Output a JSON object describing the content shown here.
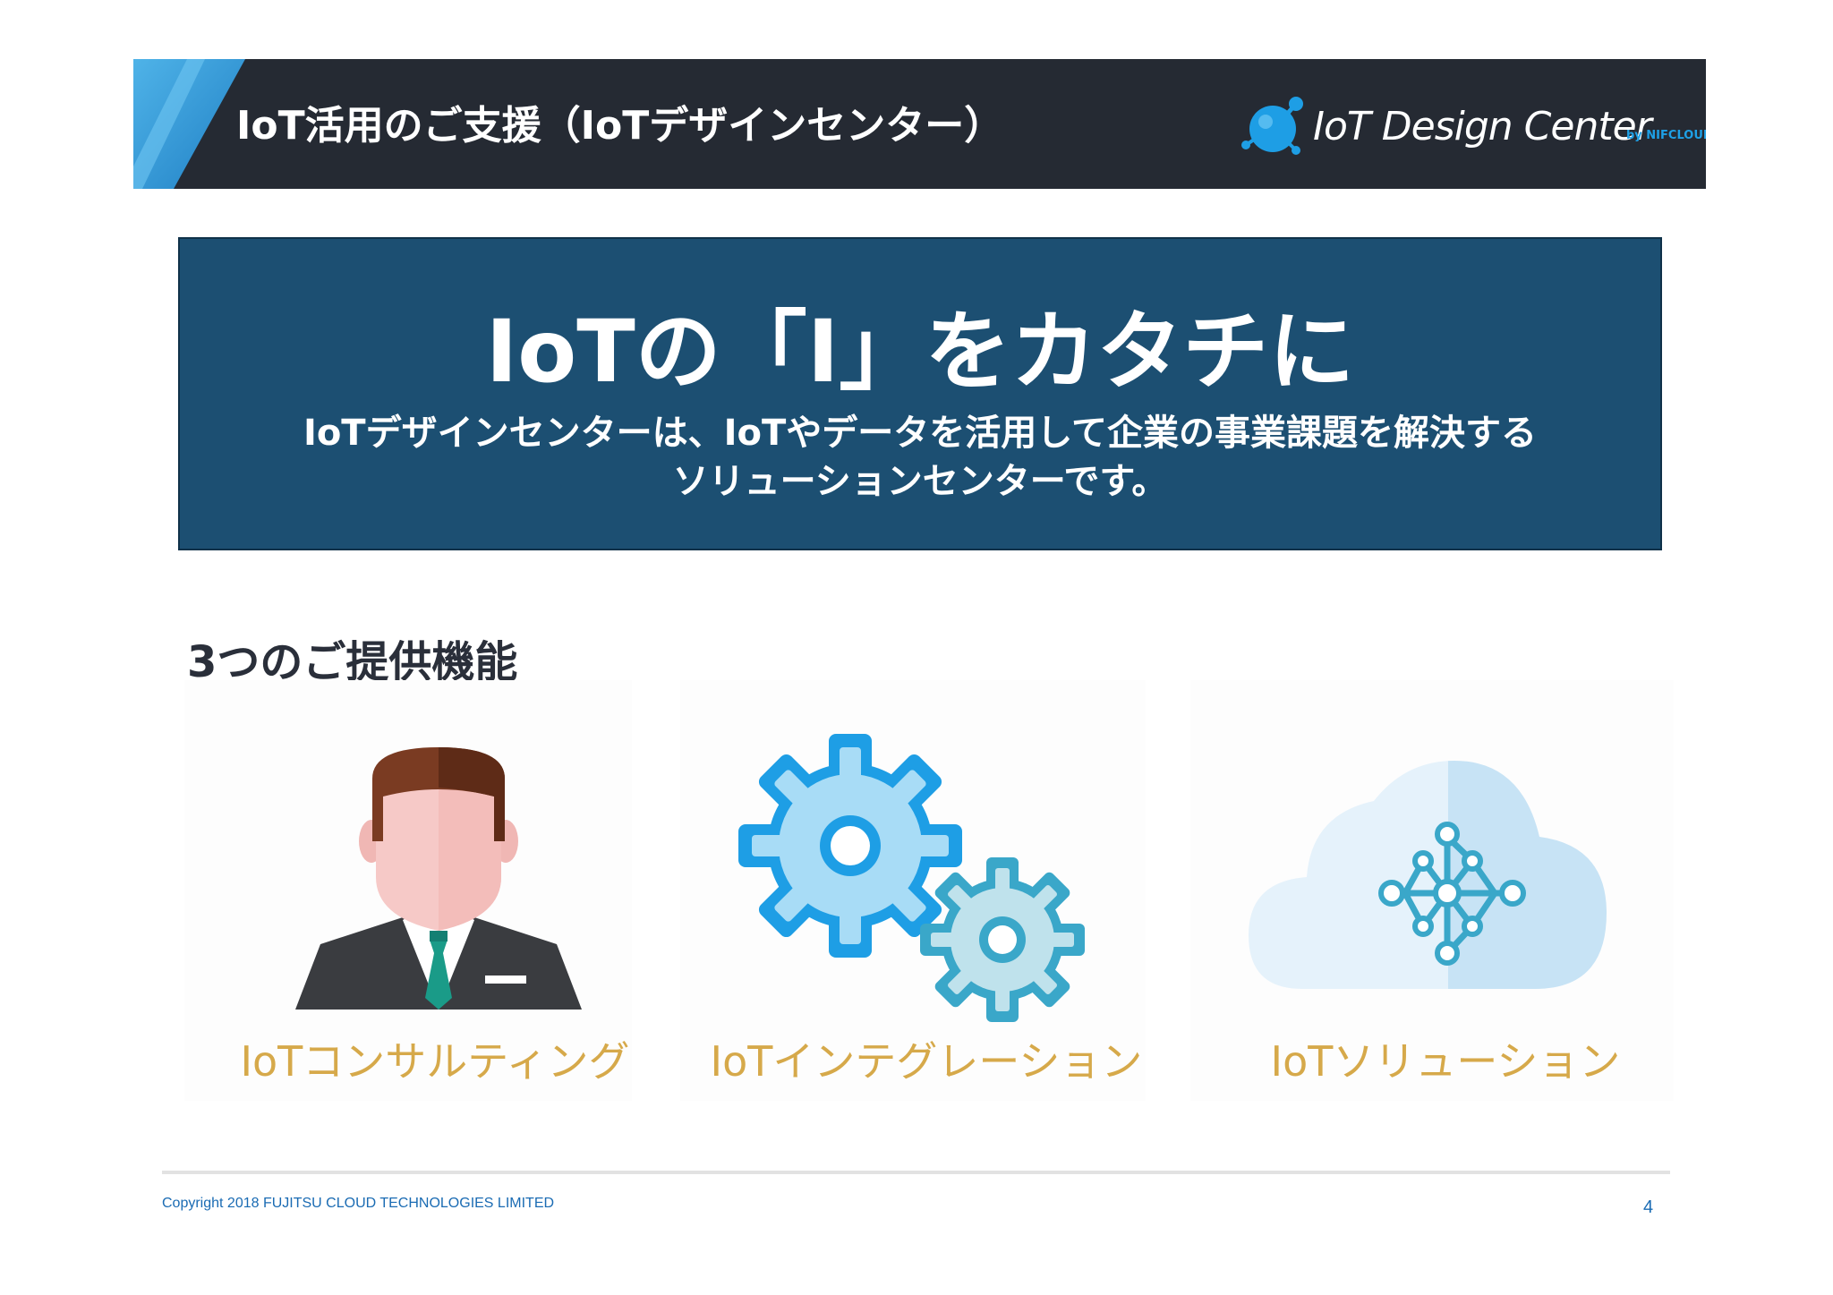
{
  "header": {
    "title": "IoT活用のご支援（IoTデザインセンター）",
    "logo_text": "IoT Design Center",
    "logo_by": "by NIFCLOUD"
  },
  "hero": {
    "title": "IoTの「I」をカタチに",
    "subtitle_line1": "IoTデザインセンターは、IoTやデータを活用して企業の事業課題を解決する",
    "subtitle_line2": "ソリューションセンターです。"
  },
  "section": {
    "title": "3つのご提供機能"
  },
  "features": [
    {
      "label": "IoTコンサルティング",
      "icon": "consultant-icon"
    },
    {
      "label": "IoTインテグレーション",
      "icon": "gears-icon"
    },
    {
      "label": "IoTソリューション",
      "icon": "cloud-network-icon"
    }
  ],
  "footer": {
    "copyright": "Copyright 2018 FUJITSU CLOUD TECHNOLOGIES LIMITED",
    "page_number": "4"
  },
  "colors": {
    "header_bg": "#252a33",
    "hero_bg": "#1c4f72",
    "accent_gold": "#d6a94a",
    "accent_blue": "#1ea0e6"
  }
}
